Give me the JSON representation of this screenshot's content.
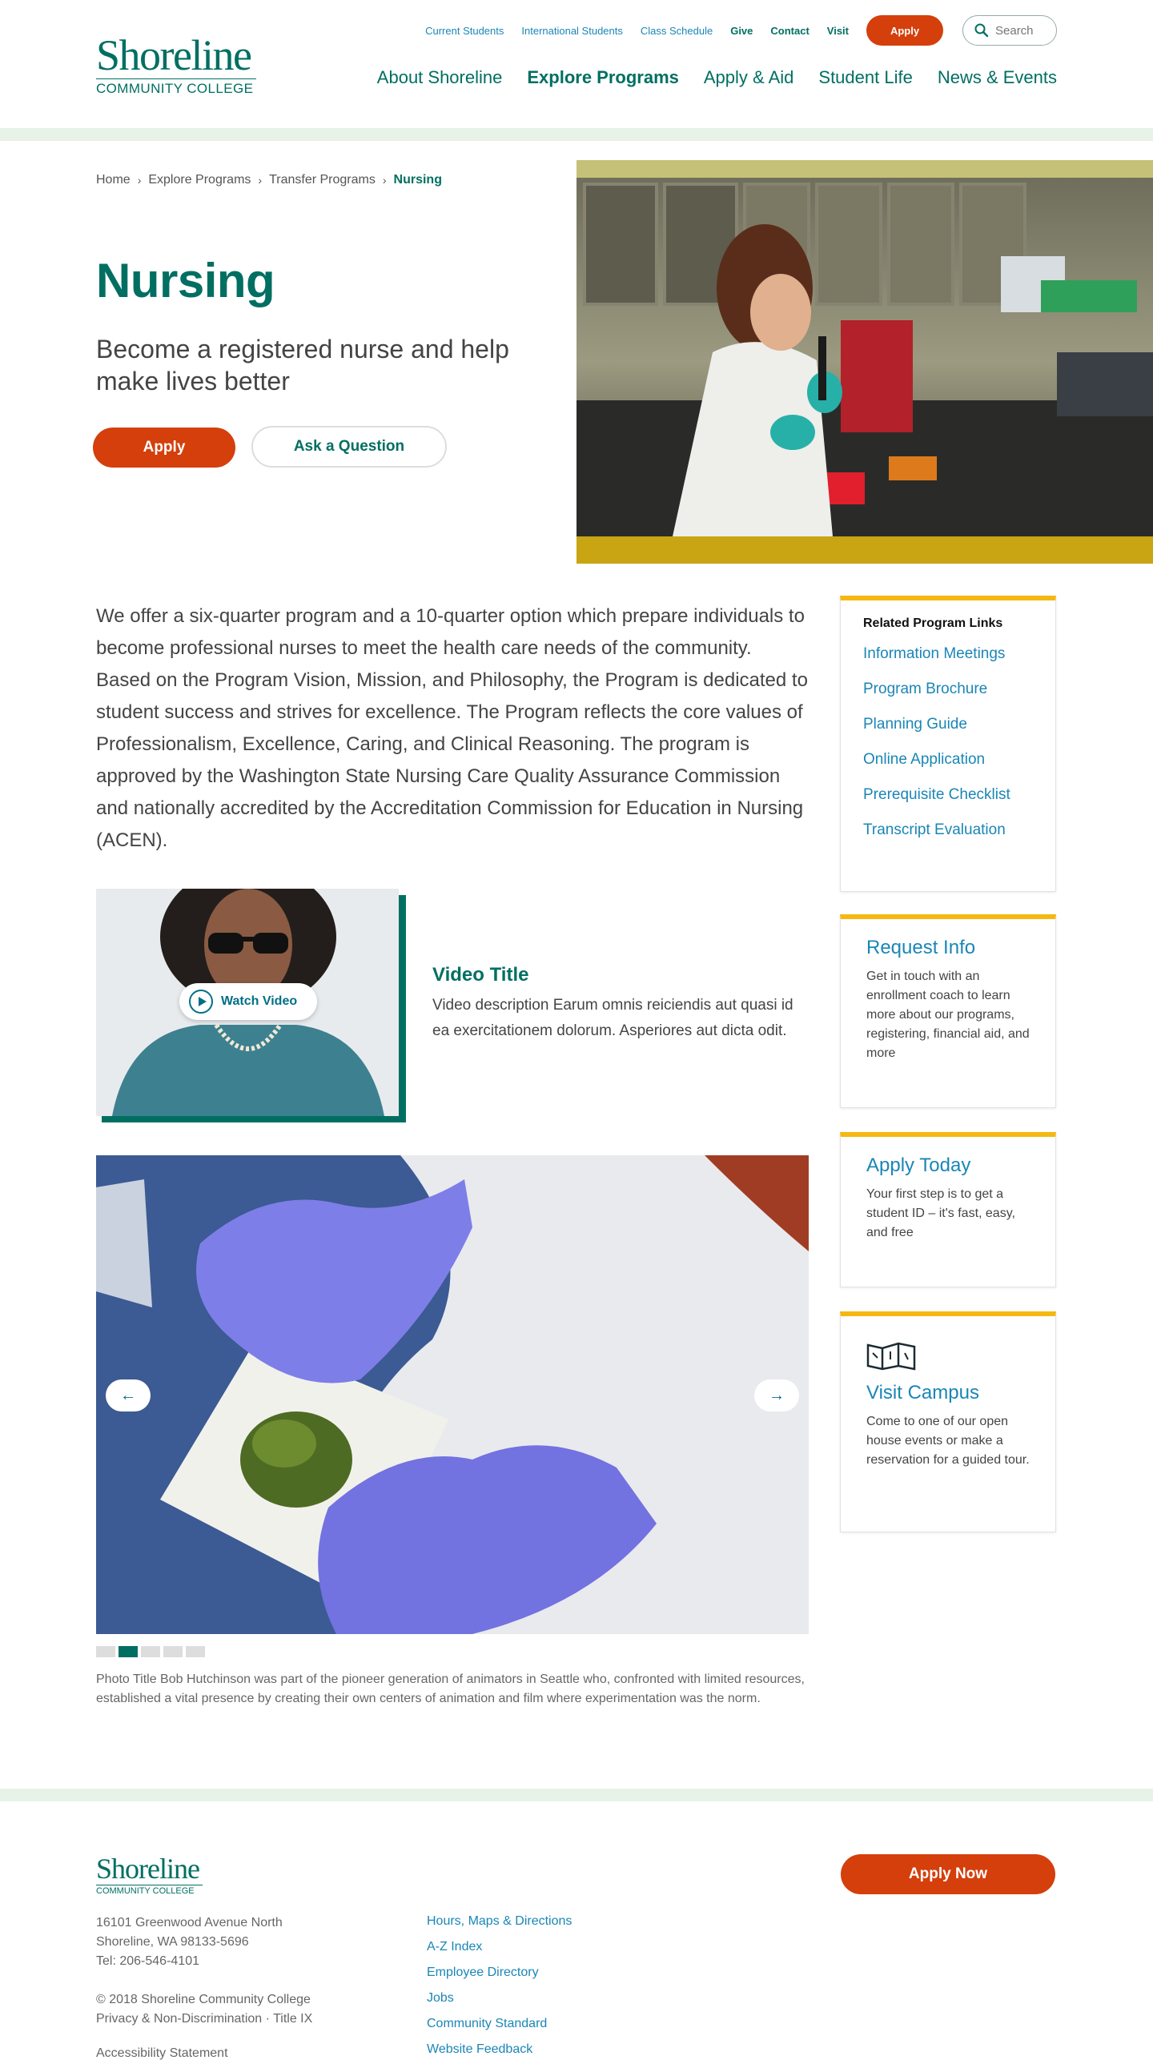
{
  "header": {
    "logo_main": "Shoreline",
    "logo_sub": "COMMUNITY COLLEGE",
    "utility_links": [
      "Current Students",
      "International Students",
      "Class Schedule"
    ],
    "utility_bold": [
      "Give",
      "Contact",
      "Visit"
    ],
    "apply_label": "Apply",
    "search_placeholder": "Search",
    "nav": [
      "About Shoreline",
      "Explore Programs",
      "Apply & Aid",
      "Student Life",
      "News & Events"
    ]
  },
  "breadcrumb": {
    "home": "Home",
    "level1": "Explore Programs",
    "level2": "Transfer Programs",
    "current": "Nursing"
  },
  "hero": {
    "title": "Nursing",
    "subtitle": "Become a registered nurse and help make lives better",
    "apply_label": "Apply",
    "ask_label": "Ask a Question"
  },
  "intro": "We offer a six-quarter program and a 10-quarter option which prepare individuals to become professional nurses to meet the health care needs of the community. Based on the Program Vision, Mission, and Philosophy, the Program is dedicated to student success and strives for excellence. The Program reflects the core values of Professionalism, Excellence, Caring, and Clinical Reasoning. The program is approved by the Washington State Nursing Care Quality Assurance Commission and nationally accredited by the Accreditation Commission for Education in Nursing (ACEN).",
  "video": {
    "watch_label": "Watch Video",
    "title": "Video Title",
    "description": "Video description Earum omnis reiciendis aut quasi id ea exercitationem dolorum. Asperiores aut dicta odit."
  },
  "carousel": {
    "prev": "←",
    "next": "→",
    "slides": 5,
    "active_slide": 2,
    "caption": "Photo Title Bob Hutchinson was part of the pioneer generation of animators in Seattle who, confronted with limited resources, established a vital presence by creating their own centers of animation and film where experimentation was the norm."
  },
  "sidebar": {
    "related_title": "Related Program Links",
    "related_links": [
      "Information Meetings",
      "Program Brochure",
      "Planning Guide",
      "Online Application",
      "Prerequisite Checklist",
      "Transcript Evaluation"
    ],
    "cards": [
      {
        "title": "Request Info",
        "text": "Get in touch with an enrollment coach to learn more about our programs, registering, financial aid, and more",
        "icon": "chat-icon"
      },
      {
        "title": "Apply Today",
        "text": "Your first step is to get a student ID – it's fast, easy, and free",
        "icon": "pencil-icon"
      },
      {
        "title": "Visit Campus",
        "text": "Come to one of our open house events or make a reservation for a guided tour.",
        "icon": "map-icon"
      }
    ]
  },
  "footer": {
    "logo_main": "Shoreline",
    "logo_sub": "COMMUNITY COLLEGE",
    "address": [
      "16101 Greenwood Avenue North",
      "Shoreline, WA 98133-5696",
      "Tel: 206-546-4101"
    ],
    "copyright": "© 2018 Shoreline Community College",
    "legal": "Privacy & Non-Discrimination · Title IX",
    "accessibility": "Accessibility Statement",
    "links": [
      "Hours, Maps & Directions",
      "A-Z Index",
      "Employee Directory",
      "Jobs",
      "Community Standard",
      "Website Feedback"
    ],
    "apply_now": "Apply Now"
  },
  "colors": {
    "brand_green": "#006f62",
    "link_blue": "#1a86b6",
    "apply_orange": "#d43f0c",
    "card_accent": "#f5b812",
    "band_green": "#e6f3e6"
  }
}
